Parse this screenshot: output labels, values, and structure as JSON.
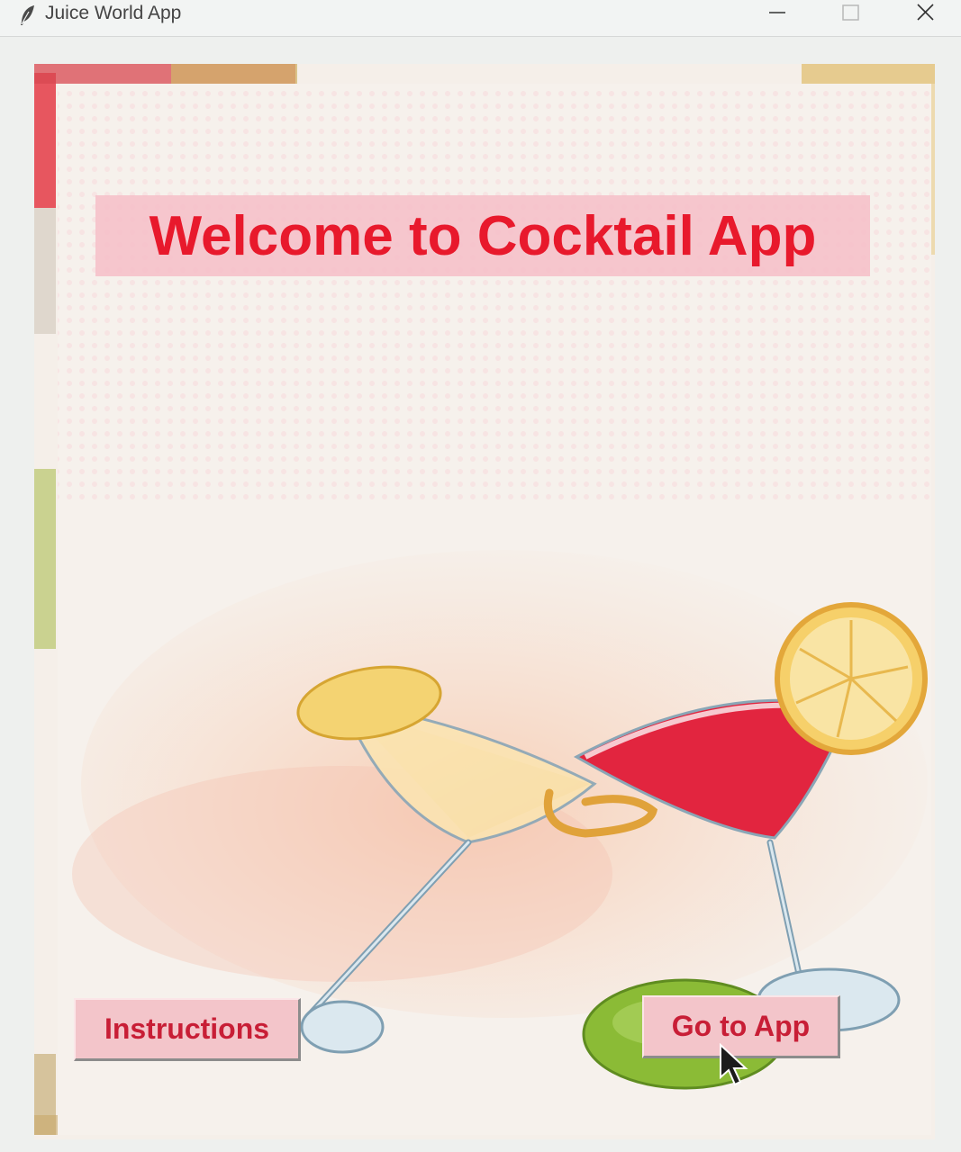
{
  "window": {
    "title": "Juice World App",
    "icon": "feather-icon",
    "controls": [
      "minimize-icon",
      "maximize-icon",
      "close-icon"
    ]
  },
  "main": {
    "welcome_text": "Welcome to Cocktail App",
    "instructions_button": "Instructions",
    "go_to_app_button": "Go to App"
  },
  "colors": {
    "title_text": "#e8192c",
    "title_bg": "#f6bec8",
    "button_bg": "#f3c5ca",
    "button_text": "#c81e36",
    "cocktail_red": "#e2253f",
    "cocktail_gold": "#f2cf72",
    "lime_green": "#8bbb36"
  },
  "illustration": {
    "subject": "two cocktail glasses clinking with lemon slices and a lime"
  }
}
